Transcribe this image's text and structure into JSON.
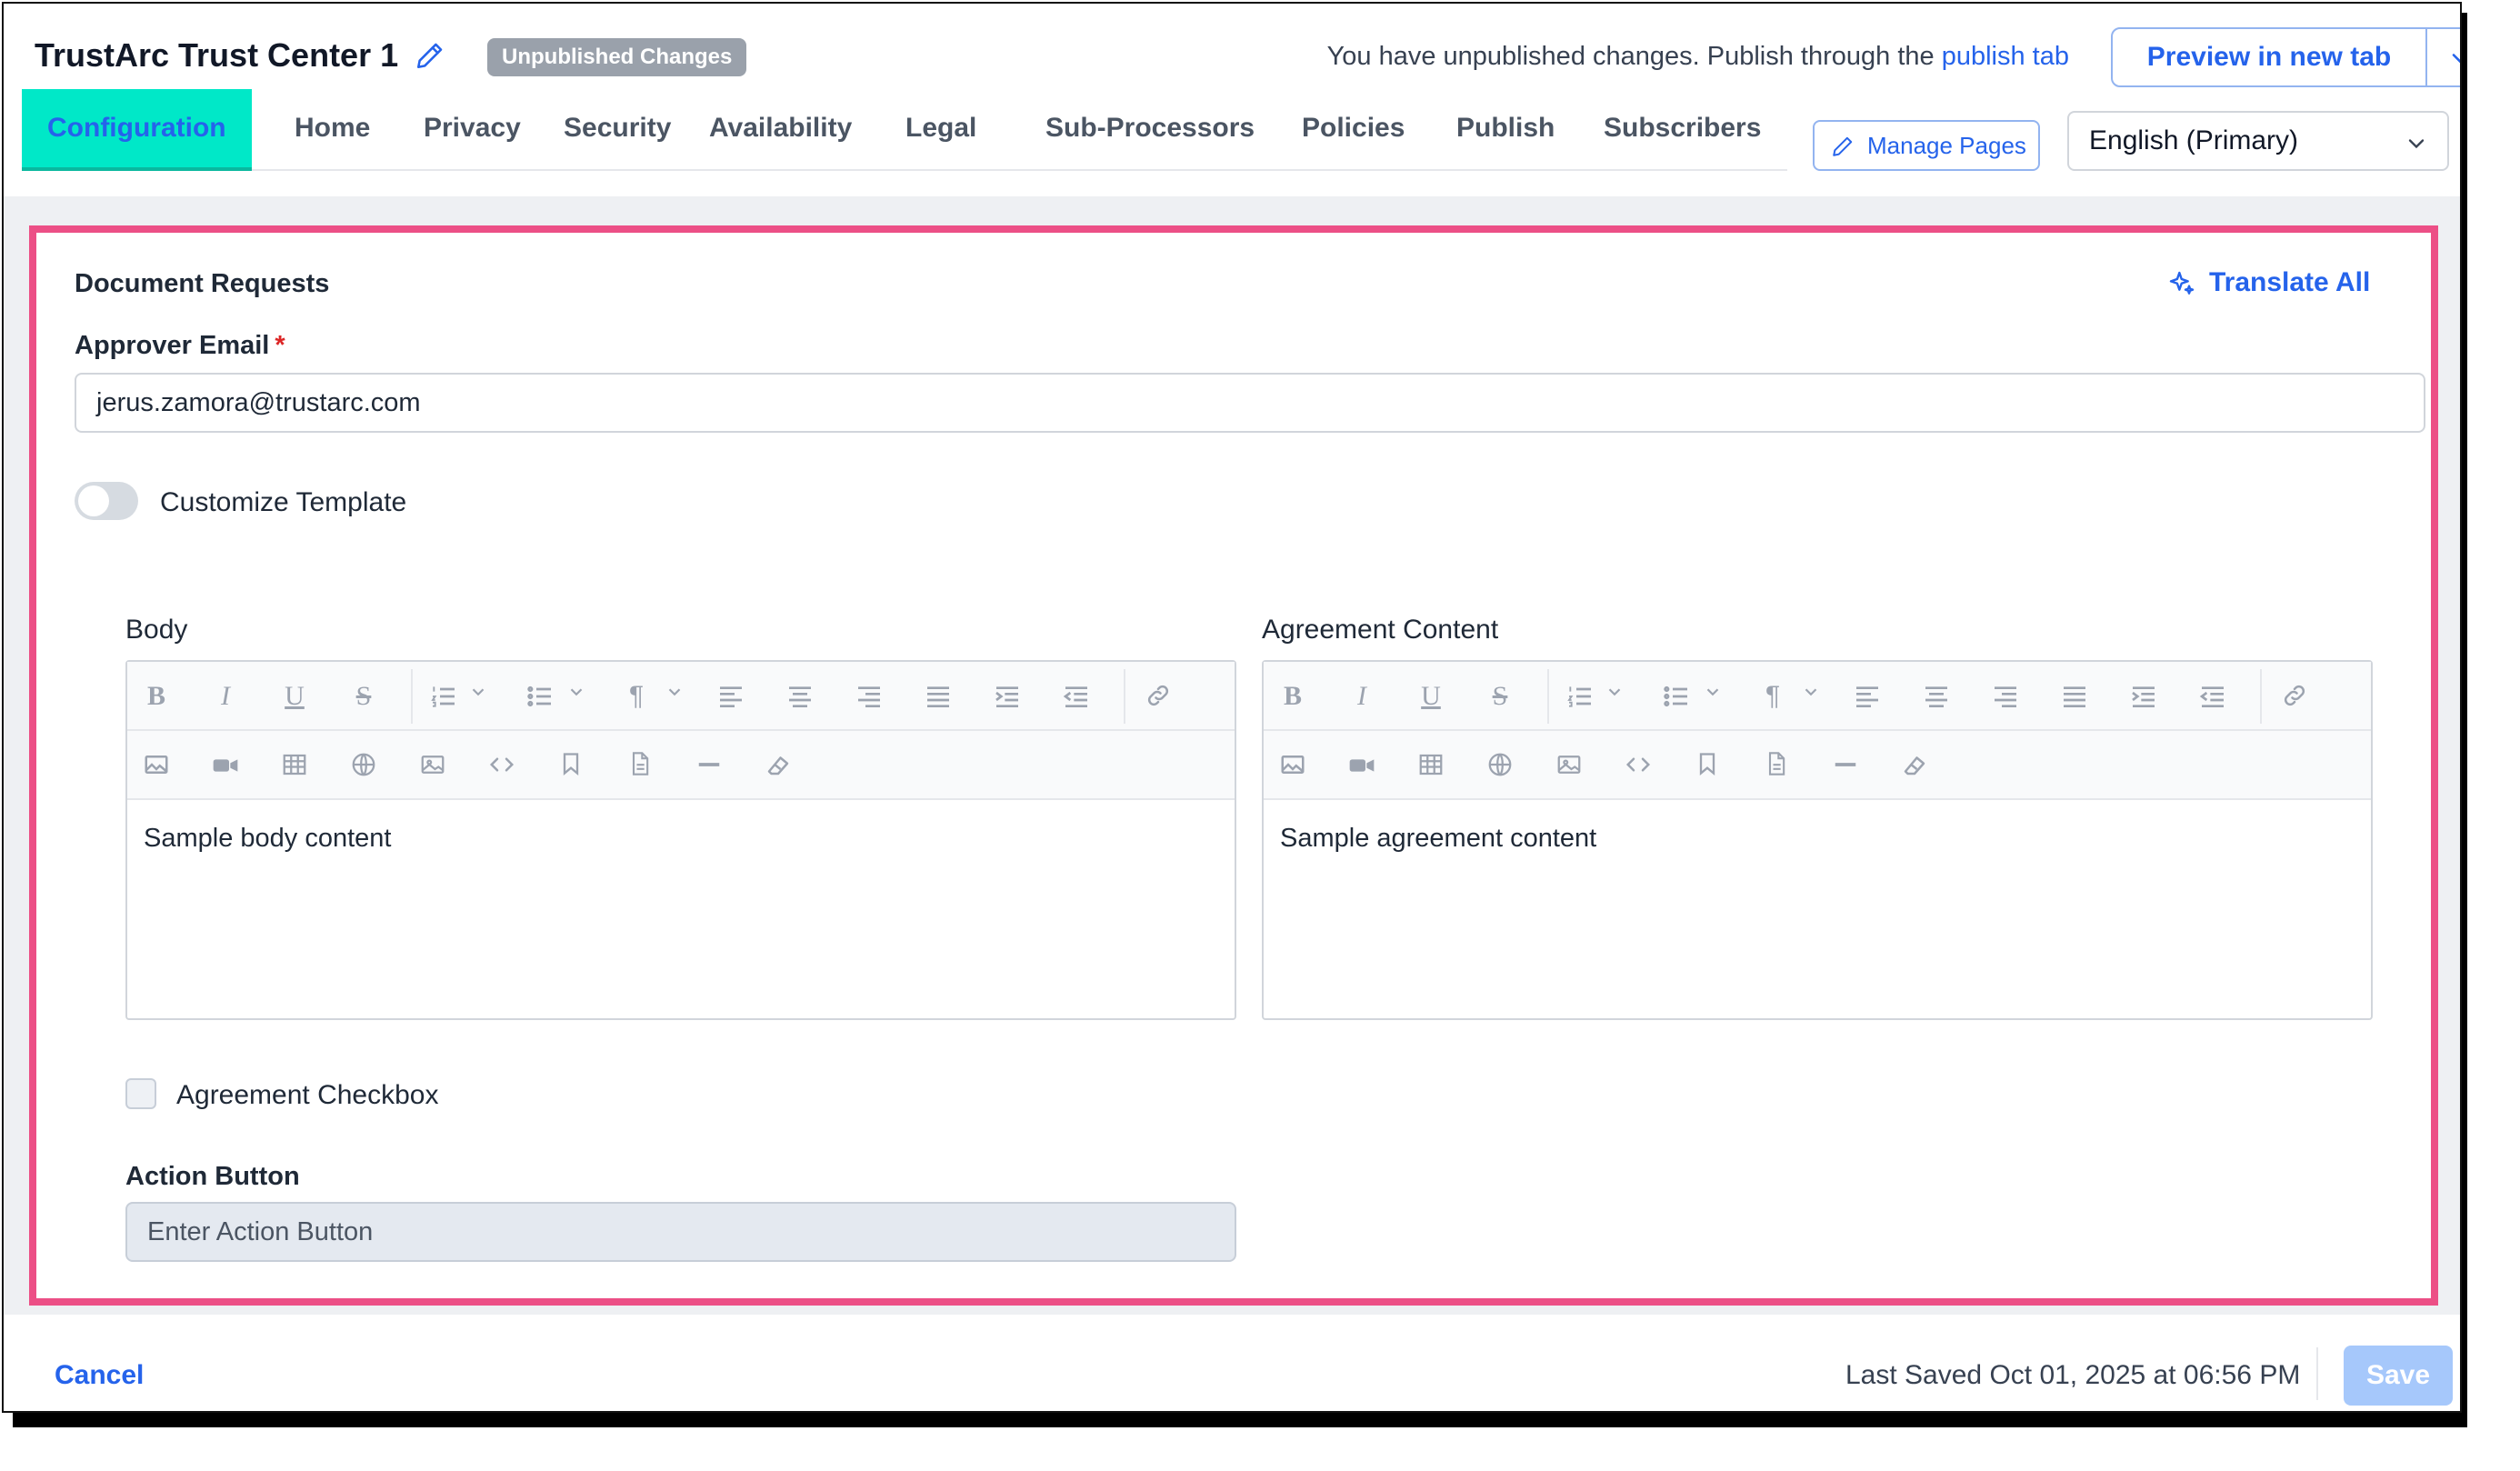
{
  "header": {
    "title": "TrustArc Trust Center 1",
    "badge": "Unpublished Changes",
    "notice_text": "You have unpublished changes. Publish through the ",
    "notice_link": "publish tab",
    "preview_label": "Preview in new tab",
    "manage_pages_label": "Manage Pages",
    "language": "English (Primary)"
  },
  "tabs": [
    "Configuration",
    "Home",
    "Privacy",
    "Security",
    "Availability",
    "Legal",
    "Sub-Processors",
    "Policies",
    "Publish",
    "Subscribers"
  ],
  "active_tab": "Configuration",
  "section": {
    "title": "Document Requests",
    "translate_all": "Translate All",
    "approver_label": "Approver Email",
    "required_mark": "*",
    "approver_value": "jerus.zamora@trustarc.com",
    "customize_label": "Customize Template",
    "customize_on": false,
    "body_label": "Body",
    "body_content": "Sample body content",
    "agreement_label": "Agreement Content",
    "agreement_content": "Sample agreement content",
    "checkbox_label": "Agreement Checkbox",
    "checkbox_checked": false,
    "action_label": "Action Button",
    "action_placeholder": "Enter Action Button"
  },
  "toolbar_icons": {
    "row1": [
      "bold-icon",
      "italic-icon",
      "underline-icon",
      "strikethrough-icon",
      "ordered-list-icon",
      "unordered-list-icon",
      "paragraph-icon",
      "align-left-icon",
      "align-center-icon",
      "align-right-icon",
      "align-justify-icon",
      "indent-icon",
      "outdent-icon",
      "link-icon"
    ],
    "row2": [
      "image-icon",
      "video-icon",
      "table-icon",
      "globe-icon",
      "media-icon",
      "code-icon",
      "bookmark-icon",
      "document-icon",
      "horizontal-rule-icon",
      "eraser-icon"
    ]
  },
  "footer": {
    "cancel_label": "Cancel",
    "last_saved": "Last Saved Oct 01, 2025 at 06:56 PM",
    "save_label": "Save"
  },
  "colors": {
    "accent": "#2563eb",
    "active_tab_bg": "#00e8c8",
    "highlight_border": "#ec4f86",
    "badge_bg": "#9aa1ab",
    "save_disabled": "#a6c8fb"
  }
}
